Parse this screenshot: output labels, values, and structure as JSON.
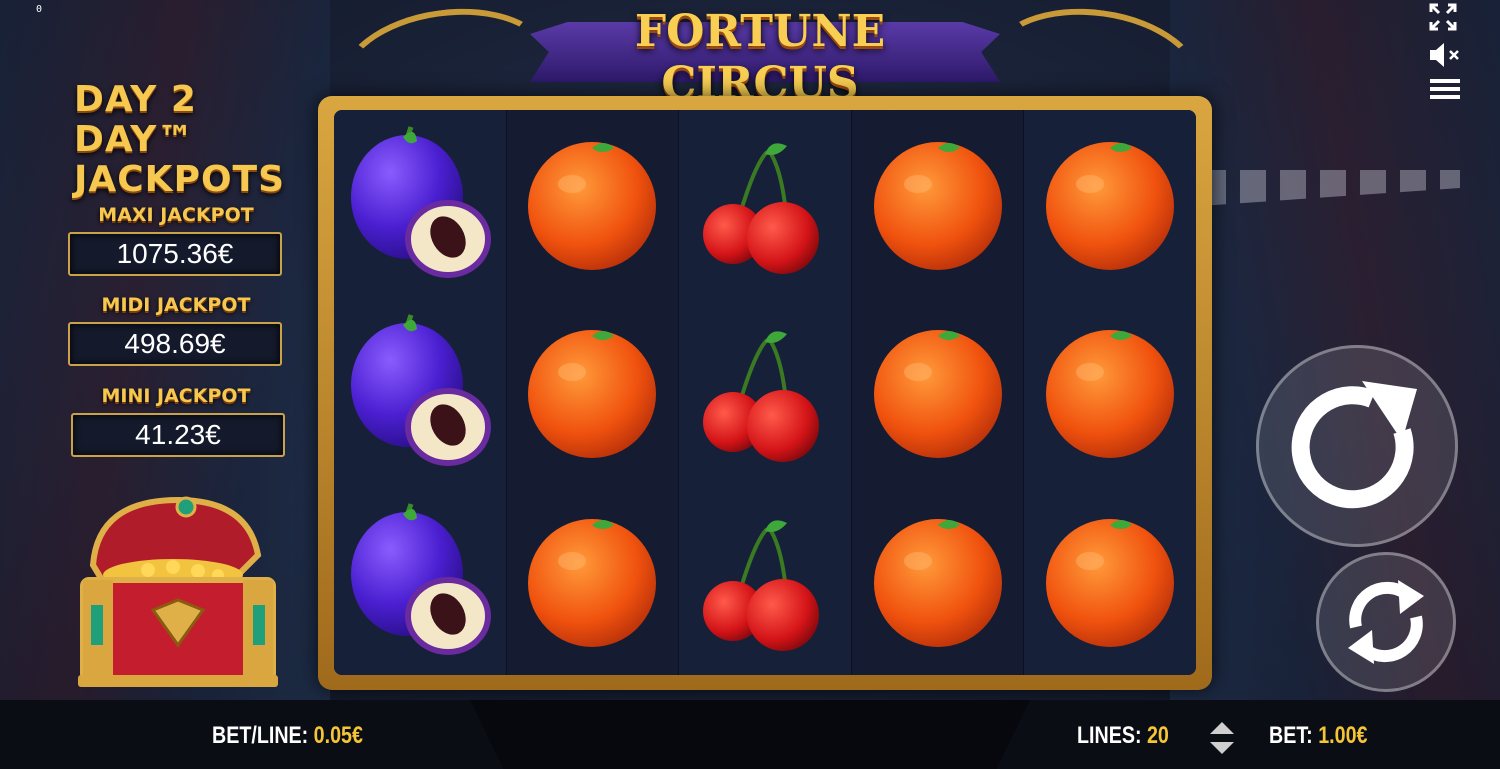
{
  "top_counter": "0",
  "game": {
    "title_line1": "FORTUNE",
    "title_line2": "CIRCUS"
  },
  "jackpots": {
    "title_line1": "DAY 2 DAY™",
    "title_line2": "JACKPOTS",
    "items": [
      {
        "label": "MAXI JACKPOT",
        "value": "1075.36€"
      },
      {
        "label": "MIDI JACKPOT",
        "value": "498.69€"
      },
      {
        "label": "MINI JACKPOT",
        "value": "41.23€"
      }
    ]
  },
  "reels": [
    [
      "plum",
      "plum",
      "plum"
    ],
    [
      "orange",
      "orange",
      "orange"
    ],
    [
      "cherry",
      "cherry",
      "cherry"
    ],
    [
      "orange",
      "orange",
      "orange"
    ],
    [
      "orange",
      "orange",
      "orange"
    ]
  ],
  "controls": {
    "fullscreen_icon": "fullscreen-icon",
    "sound_icon": "sound-muted-icon",
    "menu_icon": "menu-icon",
    "spin_icon": "spin-icon",
    "autoplay_icon": "autoplay-icon"
  },
  "bottom_bar": {
    "bet_line_label": "BET/LINE:",
    "bet_line_value": "0.05€",
    "lines_label": "LINES:",
    "lines_value": "20",
    "bet_label": "BET:",
    "bet_value": "1.00€"
  },
  "colors": {
    "accent_gold": "#f6c535",
    "frame_gold": "#c99a38",
    "reel_bg": "#151c32"
  }
}
